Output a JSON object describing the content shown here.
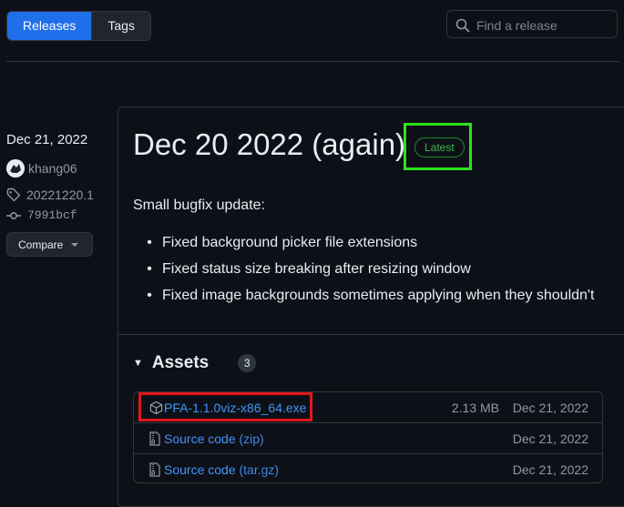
{
  "tabs": [
    {
      "label": "Releases",
      "active": true
    },
    {
      "label": "Tags",
      "active": false
    }
  ],
  "search": {
    "placeholder": "Find a release",
    "icon": "search-icon"
  },
  "release_meta": {
    "date": "Dec 21, 2022",
    "author": "khang06",
    "tag": "20221220.1",
    "commit": "7991bcf",
    "compare_label": "Compare"
  },
  "release": {
    "title": "Dec 20 2022 (again)",
    "badge": "Latest",
    "intro": "Small bugfix update:",
    "bullets": [
      "Fixed background picker file extensions",
      "Fixed status size breaking after resizing window",
      "Fixed image backgrounds sometimes applying when they shouldn't"
    ]
  },
  "assets": {
    "heading": "Assets",
    "count": "3",
    "items": [
      {
        "name": "PFA-1.1.0viz-x86_64.exe",
        "suffix": "",
        "size": "2.13 MB",
        "date": "Dec 21, 2022",
        "icon": "package-icon"
      },
      {
        "name": "Source code",
        "suffix": " (zip)",
        "size": "",
        "date": "Dec 21, 2022",
        "icon": "file-zip-icon"
      },
      {
        "name": "Source code",
        "suffix": " (tar.gz)",
        "size": "",
        "date": "Dec 21, 2022",
        "icon": "file-zip-icon"
      }
    ]
  },
  "colors": {
    "accent": "#1f6feb",
    "link": "#4493f8",
    "highlight_green": "#2ce21a",
    "highlight_red": "#e3161b",
    "background": "#0d1117"
  }
}
